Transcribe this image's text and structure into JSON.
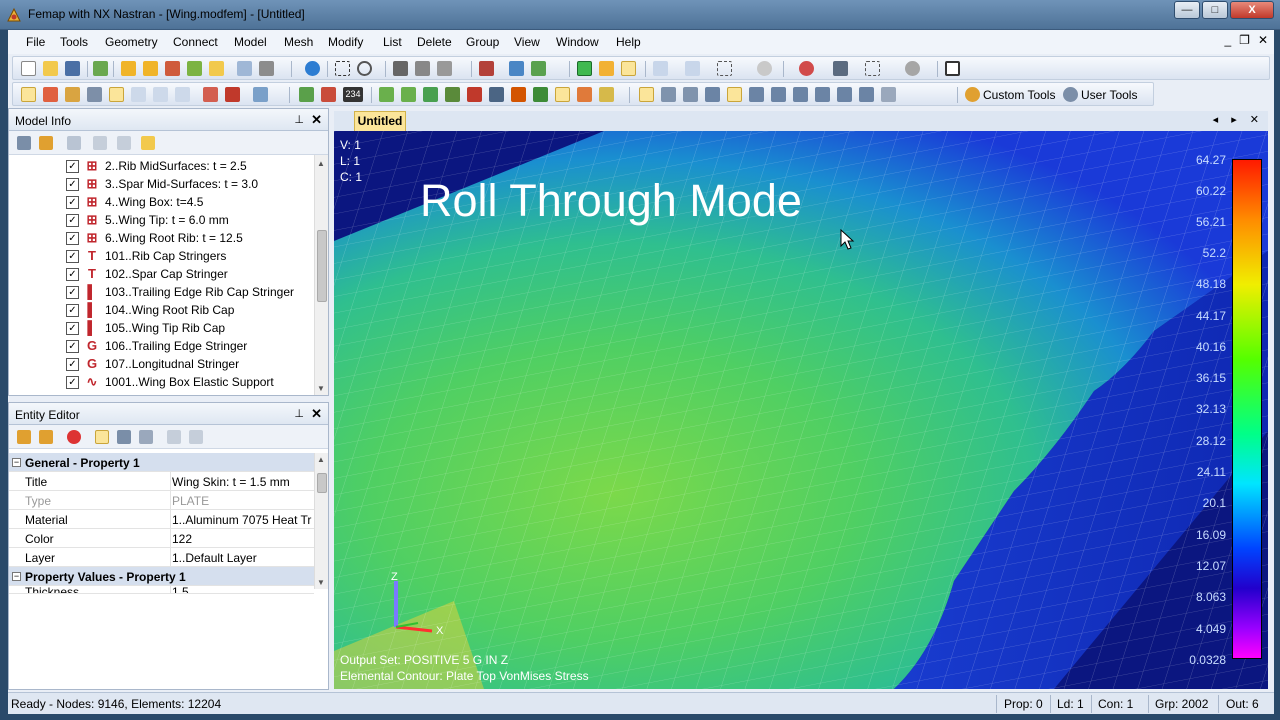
{
  "window": {
    "title": "Femap with NX Nastran - [Wing.modfem] - [Untitled]",
    "minimize": "—",
    "maximize": "□",
    "close": "X"
  },
  "menu": [
    "File",
    "Tools",
    "Geometry",
    "Connect",
    "Model",
    "Mesh",
    "Modify",
    "List",
    "Delete",
    "Group",
    "View",
    "Window",
    "Help"
  ],
  "mdi_controls": [
    "_",
    "❐",
    "✕"
  ],
  "toolbar": {
    "custom_tools": "Custom Tools",
    "user_tools": "User Tools",
    "counter_badge": "234"
  },
  "model_info": {
    "title": "Model Info",
    "pin": "⊥",
    "close": "✕",
    "items": [
      {
        "icon": "⊞",
        "label": "2..Rib MidSurfaces: t = 2.5",
        "checked": "✓"
      },
      {
        "icon": "⊞",
        "label": "3..Spar Mid-Surfaces: t = 3.0",
        "checked": "✓"
      },
      {
        "icon": "⊞",
        "label": "4..Wing Box: t=4.5",
        "checked": "✓"
      },
      {
        "icon": "⊞",
        "label": "5..Wing Tip: t = 6.0 mm",
        "checked": "✓"
      },
      {
        "icon": "⊞",
        "label": "6..Wing Root Rib: t = 12.5",
        "checked": "✓"
      },
      {
        "icon": "T",
        "label": "101..Rib Cap Stringers",
        "checked": "✓"
      },
      {
        "icon": "T",
        "label": "102..Spar Cap Stringer",
        "checked": "✓"
      },
      {
        "icon": "▌",
        "label": "103..Trailing Edge Rib Cap Stringer",
        "checked": "✓"
      },
      {
        "icon": "▌",
        "label": "104..Wing Root Rib Cap",
        "checked": "✓"
      },
      {
        "icon": "▌",
        "label": "105..Wing Tip Rib Cap",
        "checked": "✓"
      },
      {
        "icon": "G",
        "label": "106..Trailing Edge Stringer",
        "checked": "✓"
      },
      {
        "icon": "G",
        "label": "107..Longitudnal Stringer",
        "checked": "✓"
      },
      {
        "icon": "∿",
        "label": "1001..Wing Box Elastic Support",
        "checked": "✓"
      }
    ]
  },
  "entity_editor": {
    "title": "Entity Editor",
    "pin": "⊥",
    "close": "✕",
    "sections": [
      {
        "header": "General - Property 1",
        "rows": [
          {
            "key": "Title",
            "value": "Wing Skin: t = 1.5 mm"
          },
          {
            "key": "Type",
            "value": "PLATE"
          },
          {
            "key": "Material",
            "value": "1..Aluminum 7075 Heat Tr"
          },
          {
            "key": "Color",
            "value": "122"
          },
          {
            "key": "Layer",
            "value": "1..Default Layer"
          }
        ]
      },
      {
        "header": "Property Values - Property 1",
        "rows": [
          {
            "key": "Thickness",
            "value": "1.5"
          }
        ]
      }
    ]
  },
  "view": {
    "tab": "Untitled",
    "tab_nav": "◂ ▸ ✕",
    "info": [
      "V: 1",
      "L: 1",
      "C: 1"
    ],
    "banner": "Roll Through Mode",
    "legend": [
      "64.27",
      "60.22",
      "56.21",
      "52.2",
      "48.18",
      "44.17",
      "40.16",
      "36.15",
      "32.13",
      "28.12",
      "24.11",
      "20.1",
      "16.09",
      "12.07",
      "8.063",
      "4.049",
      "0.0328"
    ],
    "output_set": "Output Set: POSITIVE 5 G IN Z",
    "contour": "Elemental Contour: Plate Top VonMises Stress",
    "axis_z": "Z",
    "axis_x": "X",
    "colors": {
      "background": "#0b1680",
      "mesh": "#ffffff"
    }
  },
  "status": {
    "ready": "Ready - Nodes: 9146, Elements: 12204",
    "prop": "Prop: 0",
    "ld": "Ld: 1",
    "con": "Con: 1",
    "grp": "Grp: 2002",
    "out": "Out: 6"
  }
}
